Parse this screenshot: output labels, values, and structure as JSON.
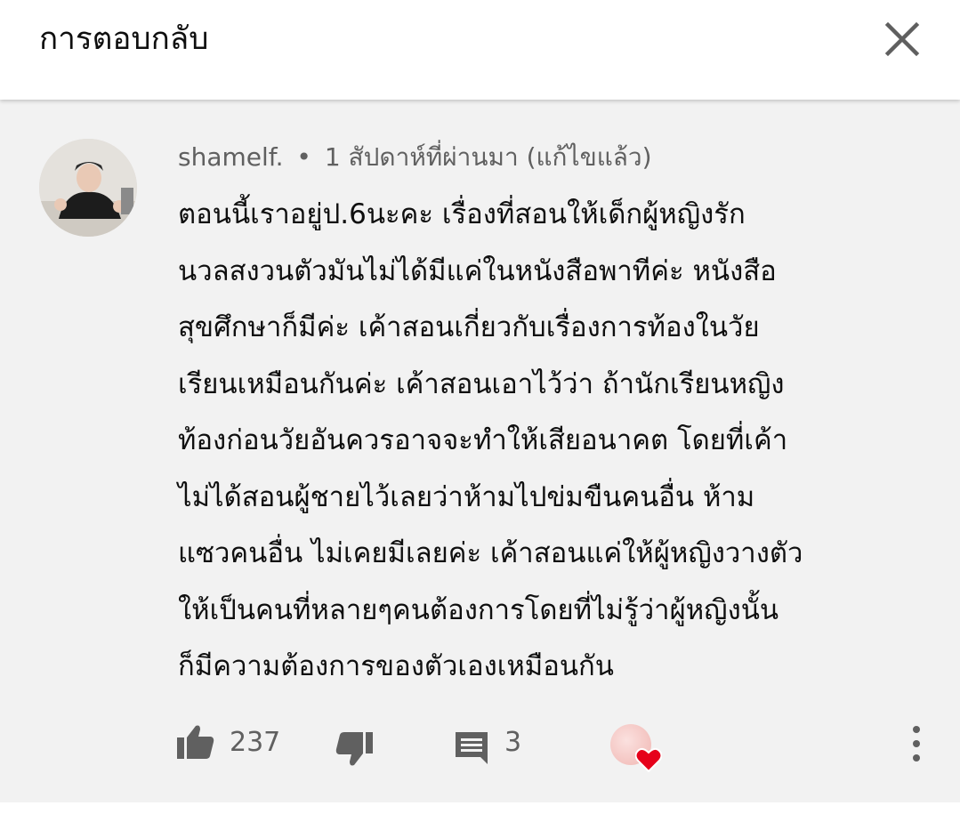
{
  "header": {
    "title": "การตอบกลับ",
    "close_icon": "close-icon"
  },
  "comment": {
    "author": "shamelf.",
    "separator": "•",
    "time": "1 สัปดาห์ที่ผ่านมา (แก้ไขแล้ว)",
    "body_lines": [
      "ตอนนี้เราอยู่ป.6นะคะ เรื่องที่สอนให้เด็กผู้หญิงรัก",
      "นวลสงวนตัวมันไม่ได้มีแค่ในหนังสือพาทีค่ะ หนังสือ",
      "สุขศึกษาก็มีค่ะ เค้าสอนเกี่ยวกับเรื่องการท้องในวัย",
      "เรียนเหมือนกันค่ะ เค้าสอนเอาไว้ว่า ถ้านักเรียนหญิง",
      "ท้องก่อนวัยอันควรอาจจะทำให้เสียอนาคต โดยที่เค้า",
      "ไม่ได้สอนผู้ชายไว้เลยว่าห้ามไปข่มขืนคนอื่น ห้าม",
      "แซวคนอื่น ไม่เคยมีเลยค่ะ เค้าสอนแค่ให้ผู้หญิงวางตัว",
      "ให้เป็นคนที่หลายๆคนต้องการโดยที่ไม่รู้ว่าผู้หญิงนั้น",
      "ก็มีความต้องการของตัวเองเหมือนกัน"
    ],
    "likes": "237",
    "replies": "3",
    "icons": {
      "like": "thumbs-up-icon",
      "dislike": "thumbs-down-icon",
      "reply": "comment-icon",
      "heart": "heart-icon",
      "more": "more-vertical-icon"
    }
  },
  "colors": {
    "background": "#f2f2f2",
    "header_bg": "#ffffff",
    "text_primary": "#0f0f0f",
    "text_secondary": "#606060",
    "heart": "#e6001a"
  }
}
